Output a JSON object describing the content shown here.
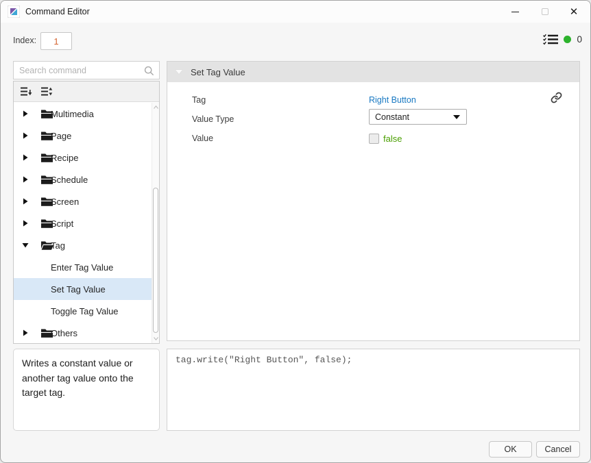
{
  "window": {
    "title": "Command Editor"
  },
  "toolbar": {
    "index_label": "Index:",
    "index_value": "1",
    "status_count": "0",
    "status_dot_color": "#2db32d"
  },
  "search": {
    "placeholder": "Search command"
  },
  "tree": {
    "items": [
      {
        "label": "Multimedia",
        "kind": "folder",
        "state": "collapsed"
      },
      {
        "label": "Page",
        "kind": "folder",
        "state": "collapsed"
      },
      {
        "label": "Recipe",
        "kind": "folder",
        "state": "collapsed"
      },
      {
        "label": "Schedule",
        "kind": "folder",
        "state": "collapsed"
      },
      {
        "label": "Screen",
        "kind": "folder",
        "state": "collapsed"
      },
      {
        "label": "Script",
        "kind": "folder",
        "state": "collapsed"
      },
      {
        "label": "Tag",
        "kind": "folder",
        "state": "expanded"
      },
      {
        "label": "Enter Tag Value",
        "kind": "command",
        "selected": false
      },
      {
        "label": "Set Tag Value",
        "kind": "command",
        "selected": true
      },
      {
        "label": "Toggle Tag Value",
        "kind": "command",
        "selected": false
      },
      {
        "label": "Others",
        "kind": "folder",
        "state": "collapsed"
      }
    ]
  },
  "description": "Writes a constant value or another tag value onto the target tag.",
  "editor": {
    "title": "Set Tag Value",
    "tag_label": "Tag",
    "tag_value": "Right Button",
    "value_type_label": "Value Type",
    "value_type_value": "Constant",
    "value_label": "Value",
    "value_text": "false",
    "value_checkbox_checked": false
  },
  "code_preview": "tag.write(\"Right Button\", false);",
  "footer": {
    "ok": "OK",
    "cancel": "Cancel"
  },
  "colors": {
    "tag_link_blue": "#1778c2",
    "value_green": "#4a9e00",
    "index_orange": "#d4632f",
    "selected_row_blue": "#d9e8f7",
    "status_green": "#2db32d"
  }
}
